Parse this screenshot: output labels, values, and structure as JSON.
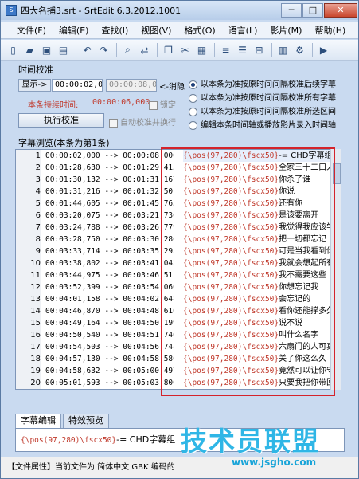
{
  "window": {
    "title": "四大名捕3.srt - SrtEdit 6.3.2012.1001",
    "min": "─",
    "max": "□",
    "close": "✕"
  },
  "menu": [
    "文件(F)",
    "编辑(E)",
    "查找(I)",
    "视图(V)",
    "格式(O)",
    "语言(L)",
    "影片(M)",
    "帮助(H)"
  ],
  "timing": {
    "group_title": "时间校准",
    "show_label": "显示",
    "arrow": "->",
    "start_time": "00:00:02,000",
    "end_time": "00:00:08,000",
    "elapse_label": "<-消隐",
    "duration_label": "本条持续时间:",
    "duration_value": "00:00:06,000",
    "lock_label": "锁定",
    "execute_button": "执行校准",
    "auto_label": "自动校准并换行",
    "options": [
      "以本条为准按原时间间隔校准后续字幕",
      "以本条为准按原时间间隔校准所有字幕",
      "以本条为准按原时间间隔校准所选区间",
      "编辑本条时间轴或播放影片录入时间轴"
    ]
  },
  "list": {
    "label": "字幕浏览(本条为第1条)",
    "rows": [
      {
        "n": "1",
        "time": "00:00:02,000 --> 00:00:08,000",
        "tag": "{\\pos(97,280)\\fscx50}",
        "text": "-= CHD字幕组 =-"
      },
      {
        "n": "2",
        "time": "00:01:28,630 --> 00:01:29,415",
        "tag": "{\\pos(97,280)\\fscx50}",
        "text": "全家三十二口人"
      },
      {
        "n": "3",
        "time": "00:01:30,132 --> 00:01:31,167",
        "tag": "{\\pos(97,280)\\fscx50}",
        "text": "你杀了谁"
      },
      {
        "n": "4",
        "time": "00:01:31,216 --> 00:01:32,501",
        "tag": "{\\pos(97,280)\\fscx50}",
        "text": "你说"
      },
      {
        "n": "5",
        "time": "00:01:44,605 --> 00:01:45,765",
        "tag": "{\\pos(97,280)\\fscx50}",
        "text": "还有你"
      },
      {
        "n": "6",
        "time": "00:03:20,075 --> 00:03:21,736",
        "tag": "{\\pos(97,280)\\fscx50}",
        "text": "是该要离开"
      },
      {
        "n": "7",
        "time": "00:03:24,788 --> 00:03:26,779",
        "tag": "{\\pos(97,280)\\fscx50}",
        "text": "我觉得我应该学会"
      },
      {
        "n": "8",
        "time": "00:03:28,750 --> 00:03:30,286",
        "tag": "{\\pos(97,280)\\fscx50}",
        "text": "把一切都忘记"
      },
      {
        "n": "9",
        "time": "00:03:33,714 --> 00:03:35,295",
        "tag": "{\\pos(97,280)\\fscx50}",
        "text": "可是当我看到你"
      },
      {
        "n": "10",
        "time": "00:03:38,802 --> 00:03:41,043",
        "tag": "{\\pos(97,280)\\fscx50}",
        "text": "我就会想起所有的一切"
      },
      {
        "n": "11",
        "time": "00:03:44,975 --> 00:03:46,511",
        "tag": "{\\pos(97,280)\\fscx50}",
        "text": "我不需要这些"
      },
      {
        "n": "12",
        "time": "00:03:52,399 --> 00:03:54,060",
        "tag": "{\\pos(97,280)\\fscx50}",
        "text": "你想忘记我"
      },
      {
        "n": "13",
        "time": "00:04:01,158 --> 00:04:02,648",
        "tag": "{\\pos(97,280)\\fscx50}",
        "text": "会忘记的"
      },
      {
        "n": "14",
        "time": "00:04:46,870 --> 00:04:48,610",
        "tag": "{\\pos(97,280)\\fscx50}",
        "text": "看你还能撑多久"
      },
      {
        "n": "15",
        "time": "00:04:49,164 --> 00:04:50,199",
        "tag": "{\\pos(97,280)\\fscx50}",
        "text": "说不说"
      },
      {
        "n": "16",
        "time": "00:04:50,540 --> 00:04:51,746",
        "tag": "{\\pos(97,280)\\fscx50}",
        "text": "叫什么名字"
      },
      {
        "n": "17",
        "time": "00:04:54,503 --> 00:04:56,744",
        "tag": "{\\pos(97,280)\\fscx50}",
        "text": "六扇门的人可真无能"
      },
      {
        "n": "18",
        "time": "00:04:57,130 --> 00:04:58,586",
        "tag": "{\\pos(97,280)\\fscx50}",
        "text": "关了你这么久"
      },
      {
        "n": "19",
        "time": "00:04:58,632 --> 00:05:00,497",
        "tag": "{\\pos(97,280)\\fscx50}",
        "text": "竟然可以让你守口如瓶"
      },
      {
        "n": "20",
        "time": "00:05:01,593 --> 00:05:03,800",
        "tag": "{\\pos(97,280)\\fscx50}",
        "text": "只要我把你带回大理寺"
      }
    ]
  },
  "tabs": [
    "字幕编辑",
    "特效预览"
  ],
  "editor": {
    "tag": "{\\pos(97,280)\\fscx50}",
    "text": "-= CHD字幕组"
  },
  "status": "【文件属性】当前文件为 简体中文 GBK 编码的",
  "watermark": {
    "main": "技术员联盟",
    "url": "www.jsgho.com"
  }
}
